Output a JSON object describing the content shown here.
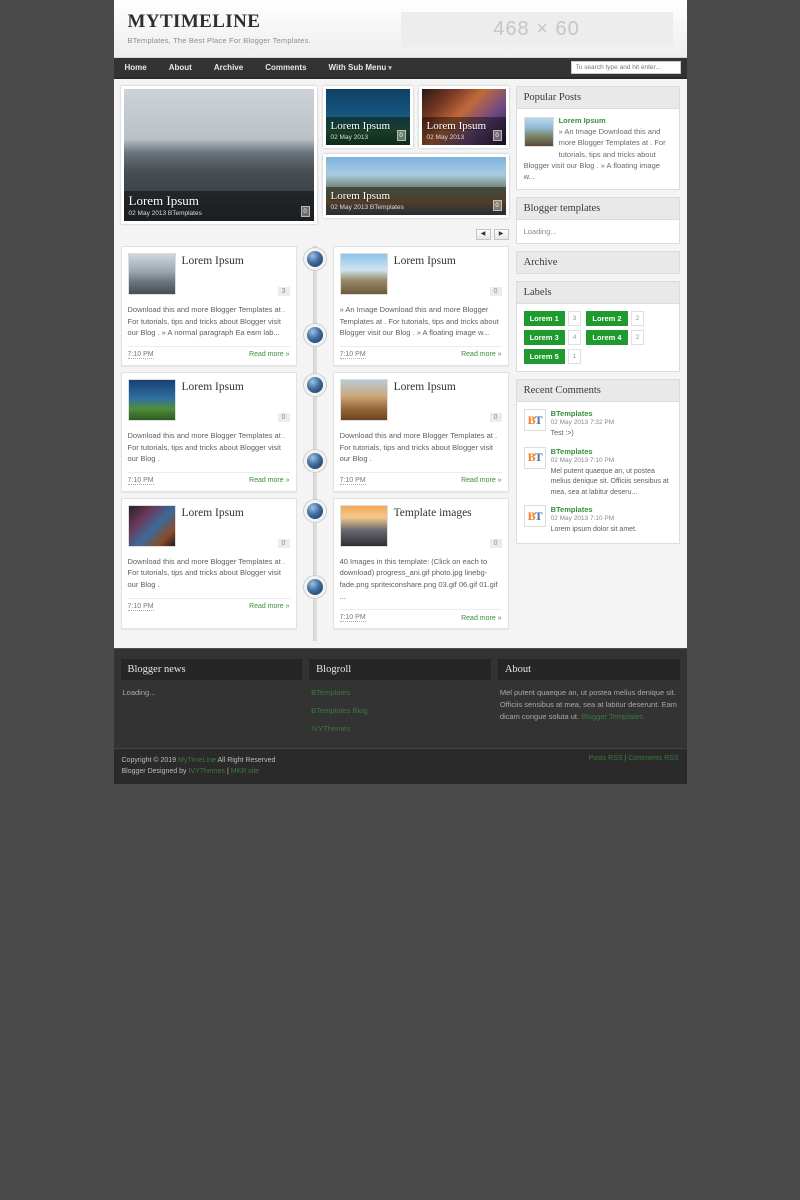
{
  "header": {
    "title": "MYTIMELINE",
    "description": "BTemplates, The Best Place For Blogger Templates.",
    "banner_label": "468 × 60"
  },
  "nav": {
    "items": [
      {
        "label": "Home"
      },
      {
        "label": "About"
      },
      {
        "label": "Archive"
      },
      {
        "label": "Comments"
      },
      {
        "label": "With Sub Menu"
      }
    ],
    "search_placeholder": "To search type and hit enter...",
    "search_value": ""
  },
  "slider": {
    "slides": [
      {
        "title": "Lorem Ipsum",
        "meta": "02 May 2013  BTemplates",
        "badge": "0"
      },
      {
        "title": "Lorem Ipsum",
        "meta": "02 May 2013",
        "badge": "0"
      },
      {
        "title": "Lorem Ipsum",
        "meta": "02 May 2013",
        "badge": "0"
      },
      {
        "title": "Lorem Ipsum",
        "meta": "02 May 2013  BTemplates",
        "badge": "0"
      }
    ],
    "prev_label": "◀",
    "next_label": "▶"
  },
  "timeline": {
    "rows": [
      {
        "left": {
          "title": "Lorem Ipsum",
          "count": "3",
          "excerpt": "Download this and more Blogger Templates at . For tutorials, tips and tricks about Blogger visit our Blog . » A normal paragraph Ea eam lab...",
          "time": "7:10 PM",
          "read_more": "Read more »"
        },
        "right": {
          "title": "Lorem Ipsum",
          "count": "0",
          "excerpt": "» An Image Download this and more Blogger Templates at . For tutorials, tips and tricks about Blogger visit our Blog . » A floating image w...",
          "time": "7:10 PM",
          "read_more": "Read more »"
        }
      },
      {
        "left": {
          "title": "Lorem Ipsum",
          "count": "0",
          "excerpt": "Download this and more Blogger Templates at . For tutorials, tips and tricks about Blogger visit our Blog .",
          "time": "7:10 PM",
          "read_more": "Read more »"
        },
        "right": {
          "title": "Lorem Ipsum",
          "count": "0",
          "excerpt": "Download this and more Blogger Templates at . For tutorials, tips and tricks about Blogger visit our Blog .",
          "time": "7:10 PM",
          "read_more": "Read more »"
        }
      },
      {
        "left": {
          "title": "Lorem Ipsum",
          "count": "0",
          "excerpt": "Download this and more Blogger Templates at . For tutorials, tips and tricks about Blogger visit our Blog .",
          "time": "7:10 PM",
          "read_more": "Read more »"
        },
        "right": {
          "title": "Template images",
          "count": "0",
          "excerpt": "40 Images in this template: (Click on each to download) progress_ani.gif photo.jpg linebg-fade.png spriteiconshare.png 03.gif 06.gif 01.gif ...",
          "time": "7:10 PM",
          "read_more": "Read more »"
        }
      }
    ]
  },
  "sidebar": {
    "popular_posts": {
      "heading": "Popular Posts",
      "item_title": "Lorem Ipsum",
      "item_snippet": "» An Image Download this and more Blogger Templates at . For tutorials, tips and tricks about Blogger visit our Blog . » A floating image w..."
    },
    "blogger_templates": {
      "heading": "Blogger templates",
      "body": "Loading..."
    },
    "archive": {
      "heading": "Archive"
    },
    "labels": {
      "heading": "Labels",
      "items": [
        {
          "name": "Lorem 1",
          "count": "3"
        },
        {
          "name": "Lorem 2",
          "count": "2"
        },
        {
          "name": "Lorem 3",
          "count": "4"
        },
        {
          "name": "Lorem 4",
          "count": "2"
        },
        {
          "name": "Lorem 5",
          "count": "1"
        }
      ]
    },
    "recent_comments": {
      "heading": "Recent Comments",
      "items": [
        {
          "author": "BTemplates",
          "date": "02 May 2013 7:32 PM",
          "text": "Test :>)"
        },
        {
          "author": "BTemplates",
          "date": "02 May 2013 7:10 PM",
          "text": "Mel putent quaeque an, ut postea melius denique sit. Officiis sensibus at mea, sea at labitur deseru..."
        },
        {
          "author": "BTemplates",
          "date": "02 May 2013 7:10 PM",
          "text": "Lorem ipsum dolor sit amet."
        }
      ]
    }
  },
  "footer": {
    "columns": [
      {
        "heading": "Blogger news",
        "body": "Loading..."
      },
      {
        "heading": "Blogroll",
        "links": [
          "BTemplates",
          "BTemplates Blog",
          "IVYThemes"
        ]
      },
      {
        "heading": "About",
        "body": "Mel putent quaeque an, ut postea melius denique sit. Officiis sensibus at mea, sea at labitur deserunt. Eam dicam congue soluta ut.",
        "link": "Blogger Templates"
      }
    ],
    "copyright_prefix": "Copyright © 2019",
    "copyright_brand": "MyTimeLine",
    "copyright_suffix": "All Right Reserved",
    "designed_prefix": "Blogger Designed by",
    "designed_brand": "IVYThemes",
    "designed_sep": "|",
    "designed_brand2": "MKR site",
    "rss_posts": "Posts RSS",
    "rss_sep": "|",
    "rss_comments": "Comments RSS"
  }
}
